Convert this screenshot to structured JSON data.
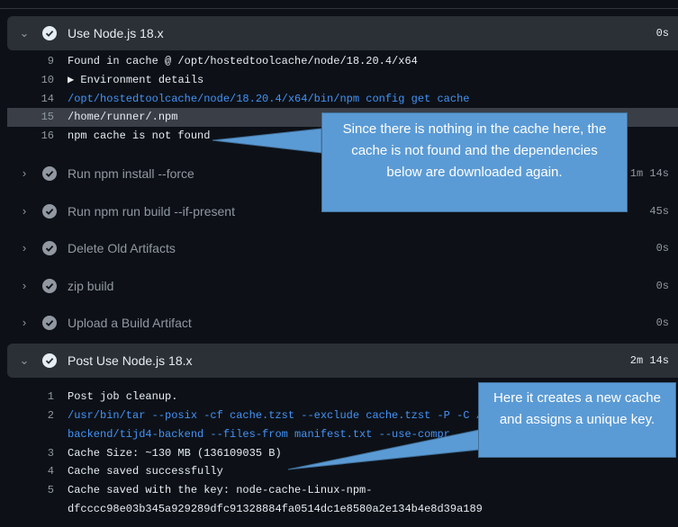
{
  "steps": [
    {
      "title": "Use Node.js 18.x",
      "duration": "0s",
      "expanded": true
    },
    {
      "title": "Run npm install --force",
      "duration": "1m 14s",
      "expanded": false
    },
    {
      "title": "Run npm run build --if-present",
      "duration": "45s",
      "expanded": false
    },
    {
      "title": "Delete Old Artifacts",
      "duration": "0s",
      "expanded": false
    },
    {
      "title": "zip build",
      "duration": "0s",
      "expanded": false
    },
    {
      "title": "Upload a Build Artifact",
      "duration": "0s",
      "expanded": false
    },
    {
      "title": "Post Use Node.js 18.x",
      "duration": "2m 14s",
      "expanded": true
    }
  ],
  "log1": [
    {
      "num": "9",
      "text": "Found in cache @ /opt/hostedtoolcache/node/18.20.4/x64"
    },
    {
      "num": "10",
      "text": "▶ Environment details"
    },
    {
      "num": "14",
      "text": "/opt/hostedtoolcache/node/18.20.4/x64/bin/npm config get cache"
    },
    {
      "num": "15",
      "text": "/home/runner/.npm"
    },
    {
      "num": "16",
      "text": "npm cache is not found"
    }
  ],
  "log2": [
    {
      "num": "1",
      "text": "Post job cleanup."
    },
    {
      "num": "2",
      "text": "/usr/bin/tar --posix -cf cache.tzst --exclude cache.tzst -P -C /ho"
    },
    {
      "num": "",
      "text": "backend/tijd4-backend --files-from manifest.txt --use-compr"
    },
    {
      "num": "3",
      "text": "Cache Size: ~130 MB (136109035 B)"
    },
    {
      "num": "4",
      "text": "Cache saved successfully"
    },
    {
      "num": "5",
      "text": "Cache saved with the key: node-cache-Linux-npm-"
    },
    {
      "num": "",
      "text": "dfcccc98e03b345a929289dfc91328884fa0514dc1e8580a2e134b4e8d39a189"
    }
  ],
  "callouts": [
    {
      "text": "Since there is nothing in the cache here, the cache is not found and the dependencies below are downloaded again."
    },
    {
      "text": "Here it creates a new cache and assigns a unique key."
    }
  ],
  "colors": {
    "background": "#0d1117",
    "active_step": "#2b2f36",
    "link_blue": "#4493f8",
    "callout_fill": "#5b9bd5"
  }
}
